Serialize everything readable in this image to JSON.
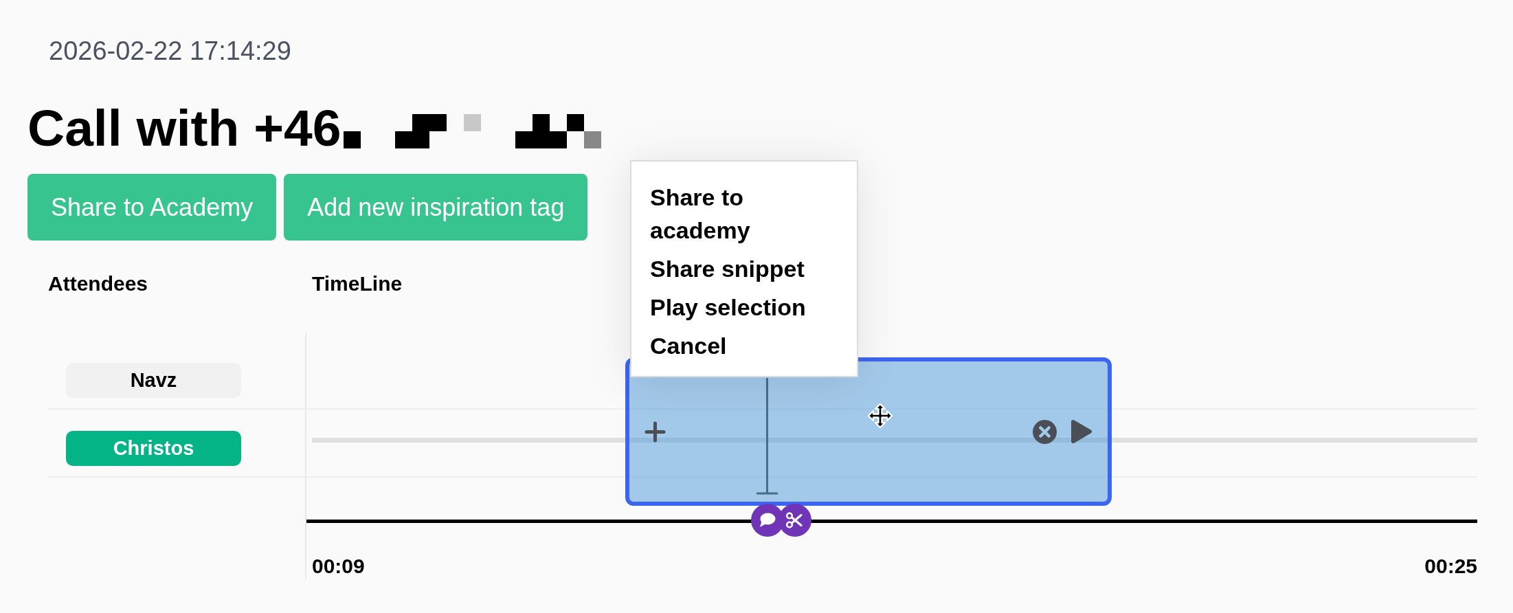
{
  "timestamp": "2026-02-22 17:14:29",
  "title": {
    "text": "Call with +46",
    "redacted": true
  },
  "actions": [
    {
      "label": "Share to Academy"
    },
    {
      "label": "Add new inspiration tag"
    }
  ],
  "columns": {
    "attendees": "Attendees",
    "timeline": "TimeLine"
  },
  "attendees": [
    {
      "name": "Navz",
      "selected": false,
      "track": false
    },
    {
      "name": "Christos",
      "selected": true,
      "track": true
    }
  ],
  "timeline": {
    "start": "00:09",
    "end": "00:25",
    "markers": [
      {
        "kind": "comment"
      },
      {
        "kind": "cut"
      }
    ]
  },
  "context_menu": {
    "items": [
      {
        "label": "Share to academy"
      },
      {
        "label": "Share snippet"
      },
      {
        "label": "Play selection"
      },
      {
        "label": "Cancel"
      }
    ]
  }
}
